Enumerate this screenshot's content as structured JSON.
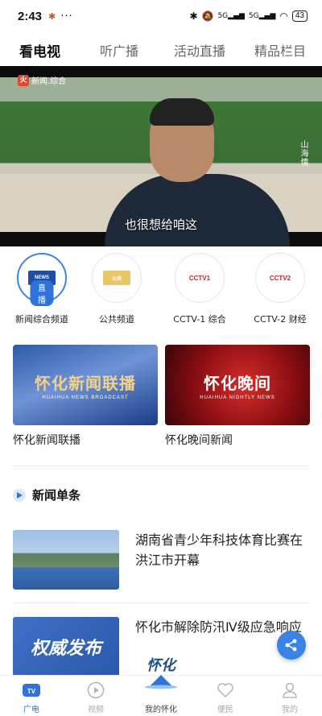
{
  "status_bar": {
    "time": "2:43",
    "signal_badge_1": "5G",
    "signal_badge_2": "5G",
    "battery": "43"
  },
  "top_tabs": [
    {
      "label": "看电视",
      "active": true
    },
    {
      "label": "听广播",
      "active": false
    },
    {
      "label": "活动直播",
      "active": false
    },
    {
      "label": "精品栏目",
      "active": false
    }
  ],
  "video": {
    "channel_logo_text": "新闻.综合",
    "side_title": "山海情",
    "subtitle": "也很想给咱这"
  },
  "channels": [
    {
      "name": "新闻综合频道",
      "badge": "直播",
      "active": true,
      "logo_color": "#1f4fa5"
    },
    {
      "name": "公共频道",
      "badge": "",
      "active": false,
      "logo_color": "#d9b24a"
    },
    {
      "name": "CCTV-1 综合",
      "badge": "",
      "active": false,
      "logo_color": "#c8242a"
    },
    {
      "name": "CCTV-2 财经",
      "badge": "",
      "active": false,
      "logo_color": "#c8242a"
    }
  ],
  "programs": [
    {
      "title": "怀化新闻联播",
      "thumb_text": "怀化新闻联播",
      "thumb_sub": "HUAIHUA NEWS BROADCAST"
    },
    {
      "title": "怀化晚间新闻",
      "thumb_text": "怀化晚间",
      "thumb_sub": "HUAIHUA NIGHTLY NEWS"
    }
  ],
  "section": {
    "title": "新闻单条"
  },
  "news": [
    {
      "headline": "湖南省青少年科技体育比赛在洪江市开幕"
    },
    {
      "headline": "怀化市解除防汛Ⅳ级应急响应",
      "thumb_text": "权威发布"
    }
  ],
  "bottom_nav": [
    {
      "label": "广电",
      "icon": "tv-icon",
      "active": true
    },
    {
      "label": "视频",
      "icon": "play-circle-icon",
      "active": false
    },
    {
      "label": "我的怀化",
      "icon": "huaihua-logo",
      "active": false
    },
    {
      "label": "便民",
      "icon": "heart-hands-icon",
      "active": false
    },
    {
      "label": "我的",
      "icon": "person-icon",
      "active": false
    }
  ],
  "center_logo_text": "怀化",
  "colors": {
    "accent": "#2f73d8",
    "share": "#3a82e4"
  }
}
